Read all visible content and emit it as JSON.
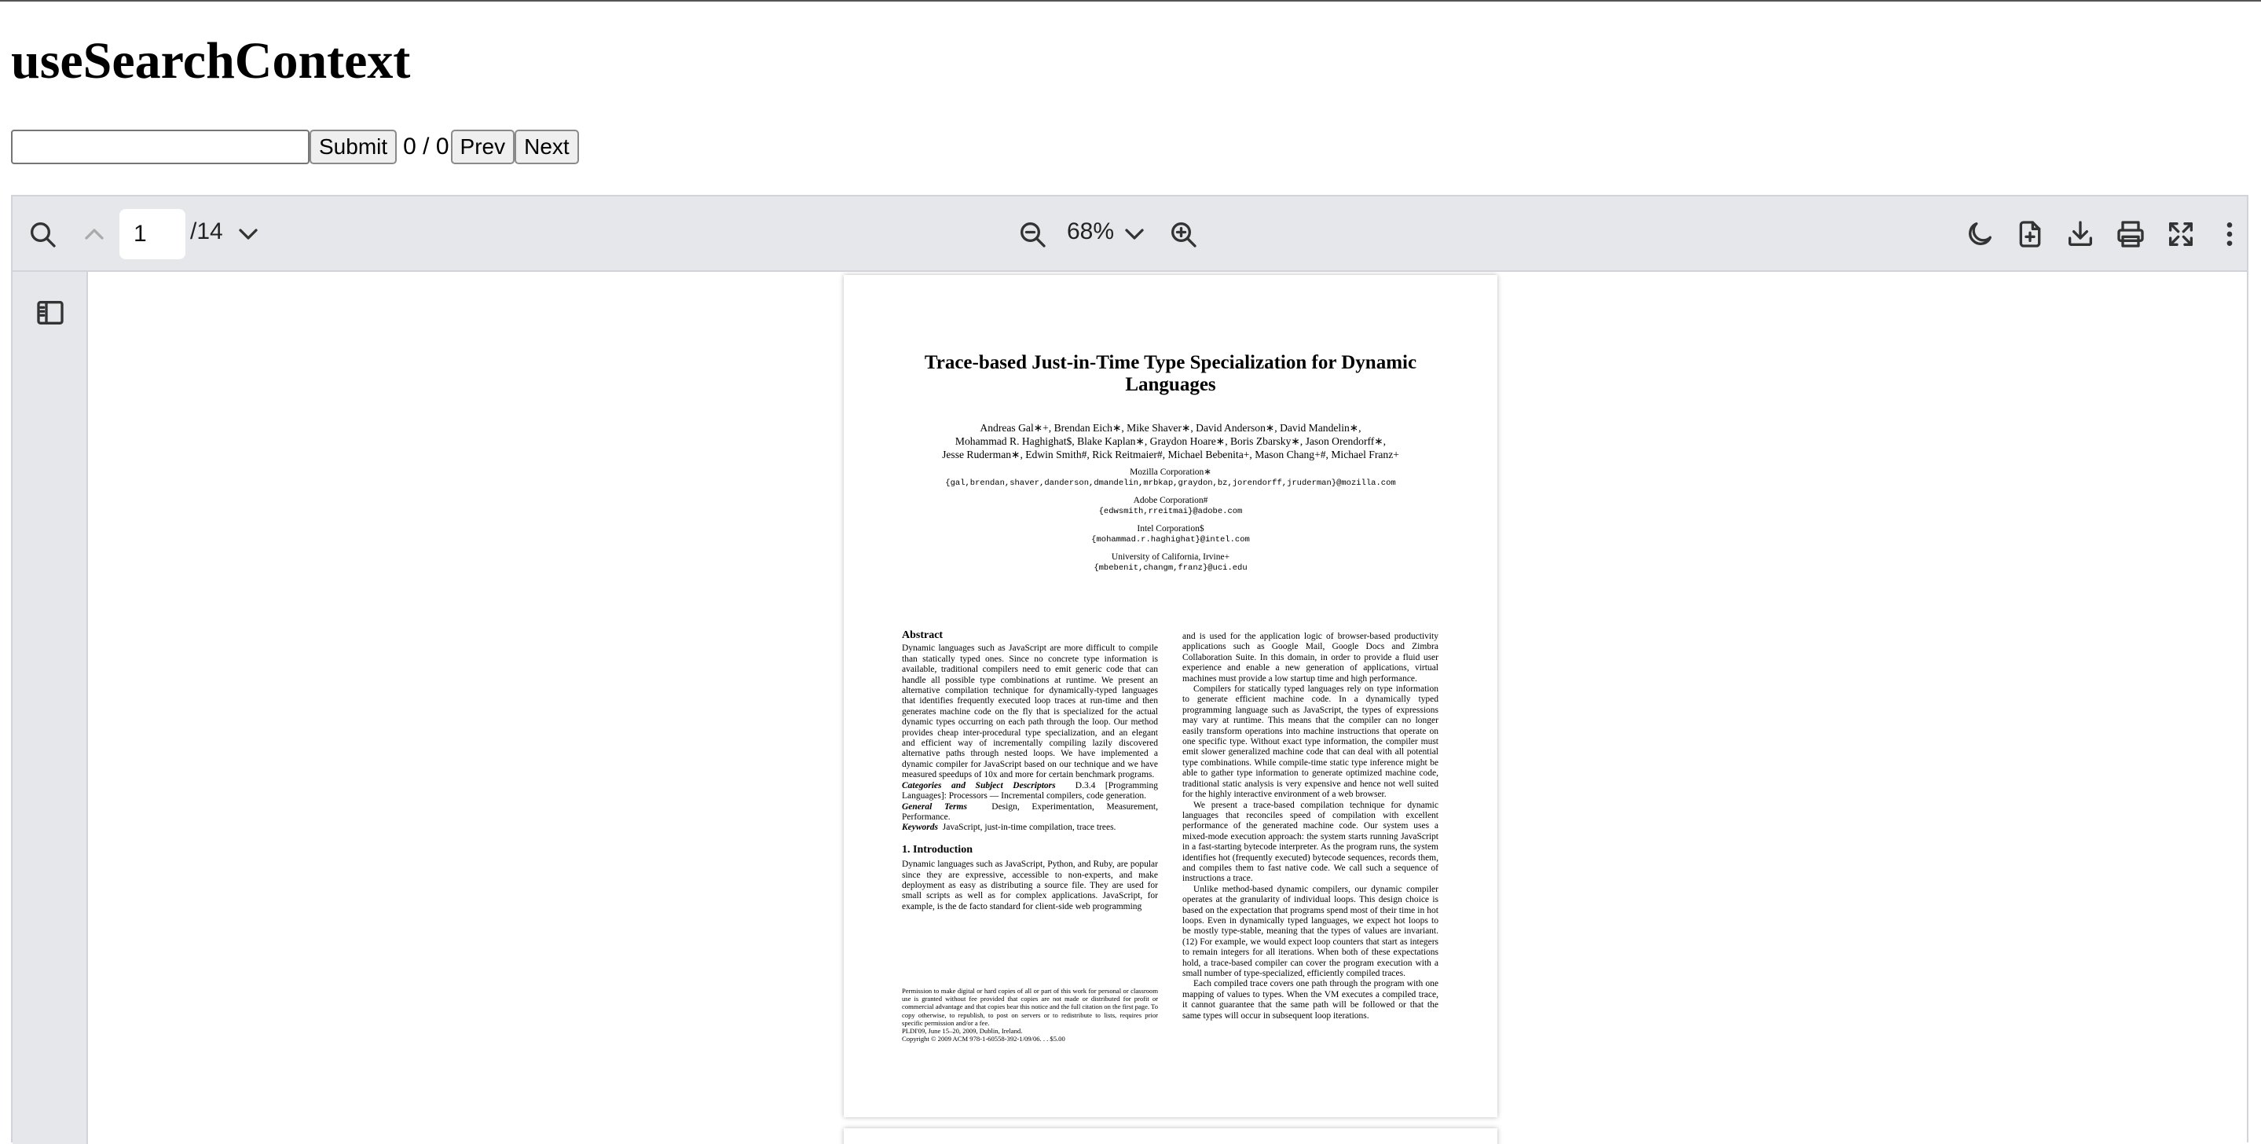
{
  "page": {
    "heading": "useSearchContext",
    "search": {
      "value": "",
      "placeholder": "",
      "submit_label": "Submit",
      "match_count": "0 / 0",
      "prev_label": "Prev",
      "next_label": "Next"
    }
  },
  "viewer": {
    "toolbar": {
      "current_page": "1",
      "total_pages": "/14",
      "zoom": "68%",
      "icons": [
        "search-icon",
        "chevron-up-icon",
        "chevron-down-icon",
        "zoom-out-icon",
        "zoom-in-icon",
        "moon-icon",
        "open-file-icon",
        "download-icon",
        "print-icon",
        "fullscreen-icon",
        "more-vertical-icon"
      ]
    },
    "sidebar": {
      "icons": [
        "sidebar-toggle-icon"
      ]
    },
    "colors": {
      "toolbar_bg": "#e5e7eb",
      "border": "#d1d5db"
    },
    "document": {
      "title": "Trace-based Just-in-Time Type Specialization for Dynamic Languages",
      "authors": [
        "Andreas Gal∗+, Brendan Eich∗, Mike Shaver∗, David Anderson∗, David Mandelin∗,",
        "Mohammad R. Haghighat$, Blake Kaplan∗, Graydon Hoare∗, Boris Zbarsky∗, Jason Orendorff∗,",
        "Jesse Ruderman∗, Edwin Smith#, Rick Reitmaier#, Michael Bebenita+, Mason Chang+#, Michael Franz+"
      ],
      "affiliations": [
        {
          "name": "Mozilla Corporation∗",
          "emails": "{gal,brendan,shaver,danderson,dmandelin,mrbkap,graydon,bz,jorendorff,jruderman}@mozilla.com"
        },
        {
          "name": "Adobe Corporation#",
          "emails": "{edwsmith,rreitmai}@adobe.com"
        },
        {
          "name": "Intel Corporation$",
          "emails": "{mohammad.r.haghighat}@intel.com"
        },
        {
          "name": "University of California, Irvine+",
          "emails": "{mbebenit,changm,franz}@uci.edu"
        }
      ],
      "abstract_heading": "Abstract",
      "abstract": "Dynamic languages such as JavaScript are more difficult to compile than statically typed ones. Since no concrete type information is available, traditional compilers need to emit generic code that can handle all possible type combinations at runtime. We present an alternative compilation technique for dynamically-typed languages that identifies frequently executed loop traces at run-time and then generates machine code on the fly that is specialized for the actual dynamic types occurring on each path through the loop. Our method provides cheap inter-procedural type specialization, and an elegant and efficient way of incrementally compiling lazily discovered alternative paths through nested loops. We have implemented a dynamic compiler for JavaScript based on our technique and we have measured speedups of 10x and more for certain benchmark programs.",
      "categories_label": "Categories and Subject Descriptors",
      "categories_text": "D.3.4 [Programming Languages]: Processors — Incremental compilers, code generation.",
      "general_terms_label": "General Terms",
      "general_terms_text": "Design, Experimentation, Measurement, Performance.",
      "keywords_label": "Keywords",
      "keywords_text": "JavaScript, just-in-time compilation, trace trees.",
      "intro_heading": "1.   Introduction",
      "intro_text": "Dynamic languages such as JavaScript, Python, and Ruby, are popular since they are expressive, accessible to non-experts, and make deployment as easy as distributing a source file. They are used for small scripts as well as for complex applications. JavaScript, for example, is the de facto standard for client-side web programming",
      "permission": "Permission to make digital or hard copies of all or part of this work for personal or classroom use is granted without fee provided that copies are not made or distributed for profit or commercial advantage and that copies bear this notice and the full citation on the first page. To copy otherwise, to republish, to post on servers or to redistribute to lists, requires prior specific permission and/or a fee.",
      "venue": "PLDI'09,    June 15–20, 2009, Dublin, Ireland.",
      "copyright": "Copyright © 2009 ACM 978-1-60558-392-1/09/06. . . $5.00",
      "right_col": [
        "and is used for the application logic of browser-based productivity applications such as Google Mail, Google Docs and Zimbra Collaboration Suite. In this domain, in order to provide a fluid user experience and enable a new generation of applications, virtual machines must provide a low startup time and high performance.",
        "Compilers for statically typed languages rely on type information to generate efficient machine code. In a dynamically typed programming language such as JavaScript, the types of expressions may vary at runtime. This means that the compiler can no longer easily transform operations into machine instructions that operate on one specific type. Without exact type information, the compiler must emit slower generalized machine code that can deal with all potential type combinations. While compile-time static type inference might be able to gather type information to generate optimized machine code, traditional static analysis is very expensive and hence not well suited for the highly interactive environment of a web browser.",
        "We present a trace-based compilation technique for dynamic languages that reconciles speed of compilation with excellent performance of the generated machine code. Our system uses a mixed-mode execution approach: the system starts running JavaScript in a fast-starting bytecode interpreter. As the program runs, the system identifies hot (frequently executed) bytecode sequences, records them, and compiles them to fast native code. We call such a sequence of instructions a trace.",
        "Unlike method-based dynamic compilers, our dynamic compiler operates at the granularity of individual loops. This design choice is based on the expectation that programs spend most of their time in hot loops. Even in dynamically typed languages, we expect hot loops to be mostly type-stable, meaning that the types of values are invariant. (12) For example, we would expect loop counters that start as integers to remain integers for all iterations. When both of these expectations hold, a trace-based compiler can cover the program execution with a small number of type-specialized, efficiently compiled traces.",
        "Each compiled trace covers one path through the program with one mapping of values to types. When the VM executes a compiled trace, it cannot guarantee that the same path will be followed or that the same types will occur in subsequent loop iterations."
      ]
    }
  }
}
